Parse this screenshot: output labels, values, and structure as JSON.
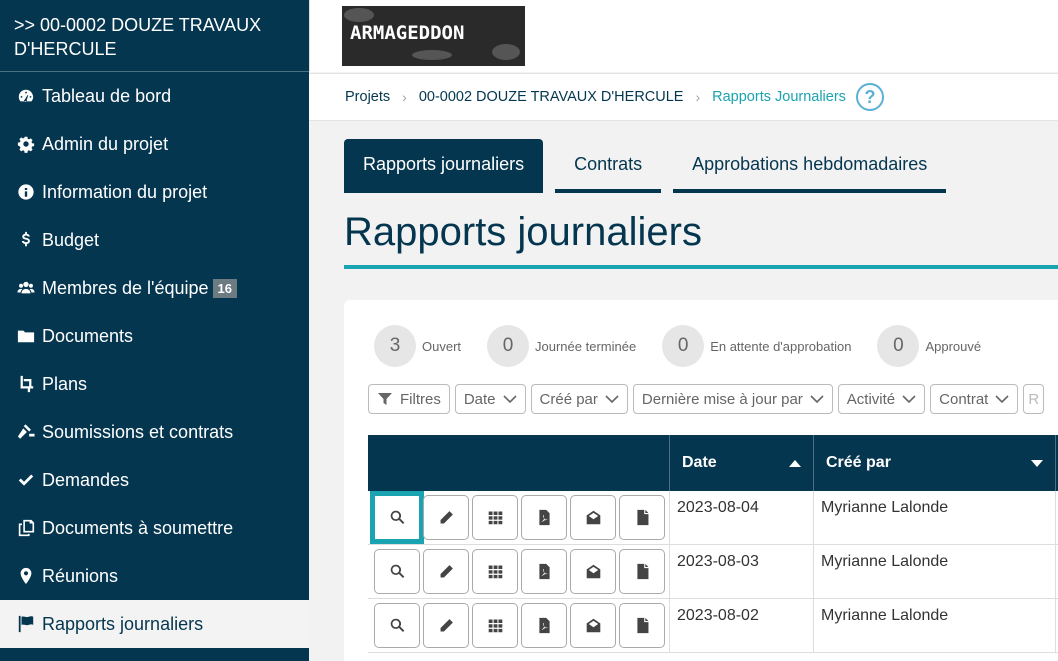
{
  "sidebar": {
    "project_title": ">> 00-0002 DOUZE TRAVAUX D'HERCULE",
    "items": [
      {
        "label": "Tableau de bord",
        "icon": "dashboard-icon"
      },
      {
        "label": "Admin du projet",
        "icon": "gear-icon"
      },
      {
        "label": "Information du projet",
        "icon": "info-icon"
      },
      {
        "label": "Budget",
        "icon": "dollar-icon"
      },
      {
        "label": "Membres de l'équipe",
        "icon": "users-icon",
        "badge": "16"
      },
      {
        "label": "Documents",
        "icon": "folder-icon"
      },
      {
        "label": "Plans",
        "icon": "crop-icon"
      },
      {
        "label": "Soumissions et contrats",
        "icon": "gavel-icon"
      },
      {
        "label": "Demandes",
        "icon": "check-icon"
      },
      {
        "label": "Documents à soumettre",
        "icon": "copy-icon"
      },
      {
        "label": "Réunions",
        "icon": "map-marker-icon"
      },
      {
        "label": "Rapports journaliers",
        "icon": "flag-icon",
        "active": true
      }
    ]
  },
  "header": {
    "logo_text": "ARMAGEDDON"
  },
  "breadcrumb": {
    "items": [
      "Projets",
      "00-0002 DOUZE TRAVAUX D'HERCULE",
      "Rapports Journaliers"
    ],
    "help": "?"
  },
  "tabs": [
    {
      "label": "Rapports journaliers",
      "active": true
    },
    {
      "label": "Contrats"
    },
    {
      "label": "Approbations hebdomadaires"
    }
  ],
  "page_title": "Rapports journaliers",
  "counters": [
    {
      "value": "3",
      "label": "Ouvert"
    },
    {
      "value": "0",
      "label": "Journée terminée"
    },
    {
      "value": "0",
      "label": "En attente d'approbation"
    },
    {
      "value": "0",
      "label": "Approuvé"
    }
  ],
  "filters": {
    "filtres": "Filtres",
    "date": "Date",
    "cree_par": "Créé par",
    "derniere_maj": "Dernière mise à jour par",
    "activite": "Activité",
    "contrat": "Contrat",
    "cut_off": "R"
  },
  "table": {
    "headers": {
      "date": "Date",
      "cree_par": "Créé par"
    },
    "rows": [
      {
        "date": "2023-08-04",
        "cree_par": "Myrianne Lalonde"
      },
      {
        "date": "2023-08-03",
        "cree_par": "Myrianne Lalonde"
      },
      {
        "date": "2023-08-02",
        "cree_par": "Myrianne Lalonde"
      }
    ]
  },
  "colors": {
    "navy": "#05364f",
    "teal": "#1aa3b0",
    "background": "#f2f2f2"
  }
}
